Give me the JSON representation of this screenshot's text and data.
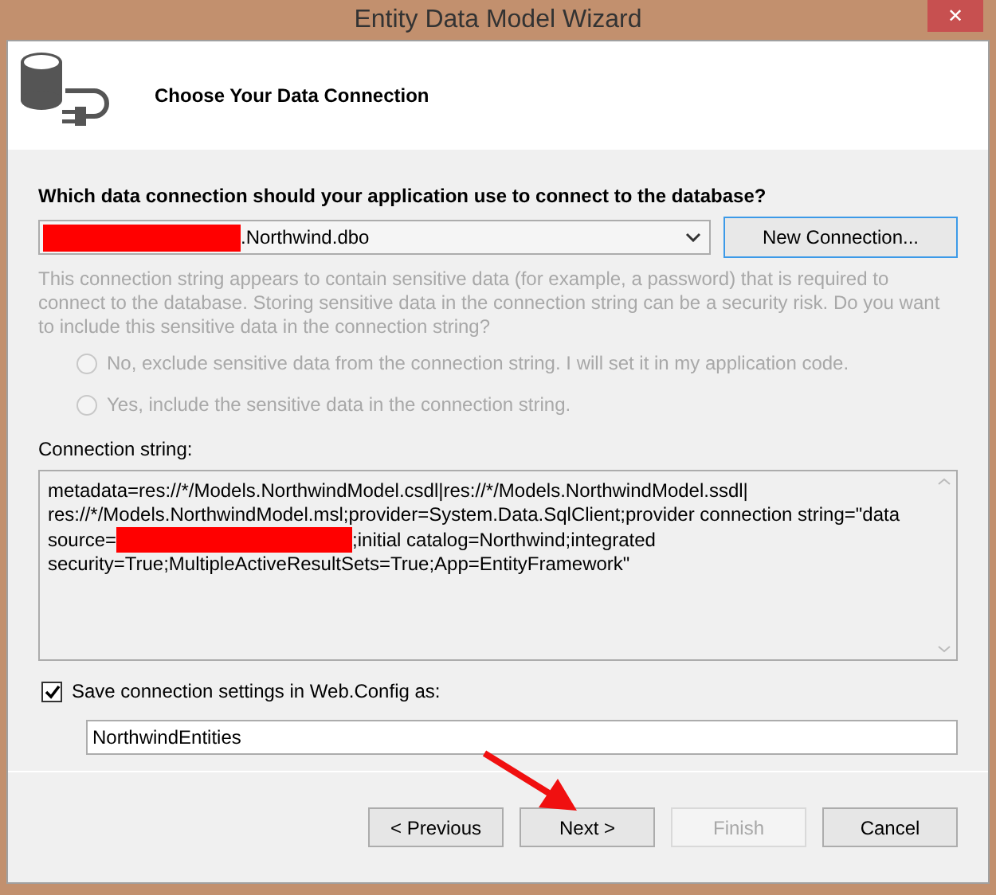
{
  "window": {
    "title": "Entity Data Model Wizard",
    "close_label": "✕"
  },
  "header": {
    "title": "Choose Your Data Connection"
  },
  "question": "Which data connection should your application use to connect to the database?",
  "connection_dropdown": {
    "value": ".Northwind.dbo",
    "redacted": true
  },
  "new_connection_button": "New Connection...",
  "sensitive_notice": {
    "text": "This connection string appears to contain sensitive data (for example, a password) that is required to connect to the database. Storing sensitive data in the connection string can be a security risk. Do you want to include this sensitive data in the connection string?",
    "disabled": true
  },
  "radios": [
    {
      "label": "No, exclude sensitive data from the connection string. I will set it in my application code.",
      "selected": false,
      "disabled": true
    },
    {
      "label": "Yes, include the sensitive data in the connection string.",
      "selected": false,
      "disabled": true
    }
  ],
  "connection_string": {
    "label": "Connection string:",
    "lines": [
      {
        "kind": "text",
        "text": "metadata=res://*/Models.NorthwindModel.csdl|res://*/Models.NorthwindModel.ssdl|"
      },
      {
        "kind": "text",
        "text": "res://*/Models.NorthwindModel.msl;provider=System.Data.SqlClient;provider connection string=\"data"
      },
      {
        "kind": "redacted",
        "before": "source=",
        "after": ";initial catalog=Northwind;integrated"
      },
      {
        "kind": "text",
        "text": "security=True;MultipleActiveResultSets=True;App=EntityFramework\""
      }
    ]
  },
  "save_settings": {
    "label": "Save connection settings in Web.Config as:",
    "checked": true,
    "value": "NorthwindEntities"
  },
  "buttons": [
    {
      "label": "< Previous",
      "disabled": false
    },
    {
      "label": "Next >",
      "disabled": false
    },
    {
      "label": "Finish",
      "disabled": true
    },
    {
      "label": "Cancel",
      "disabled": false
    }
  ]
}
